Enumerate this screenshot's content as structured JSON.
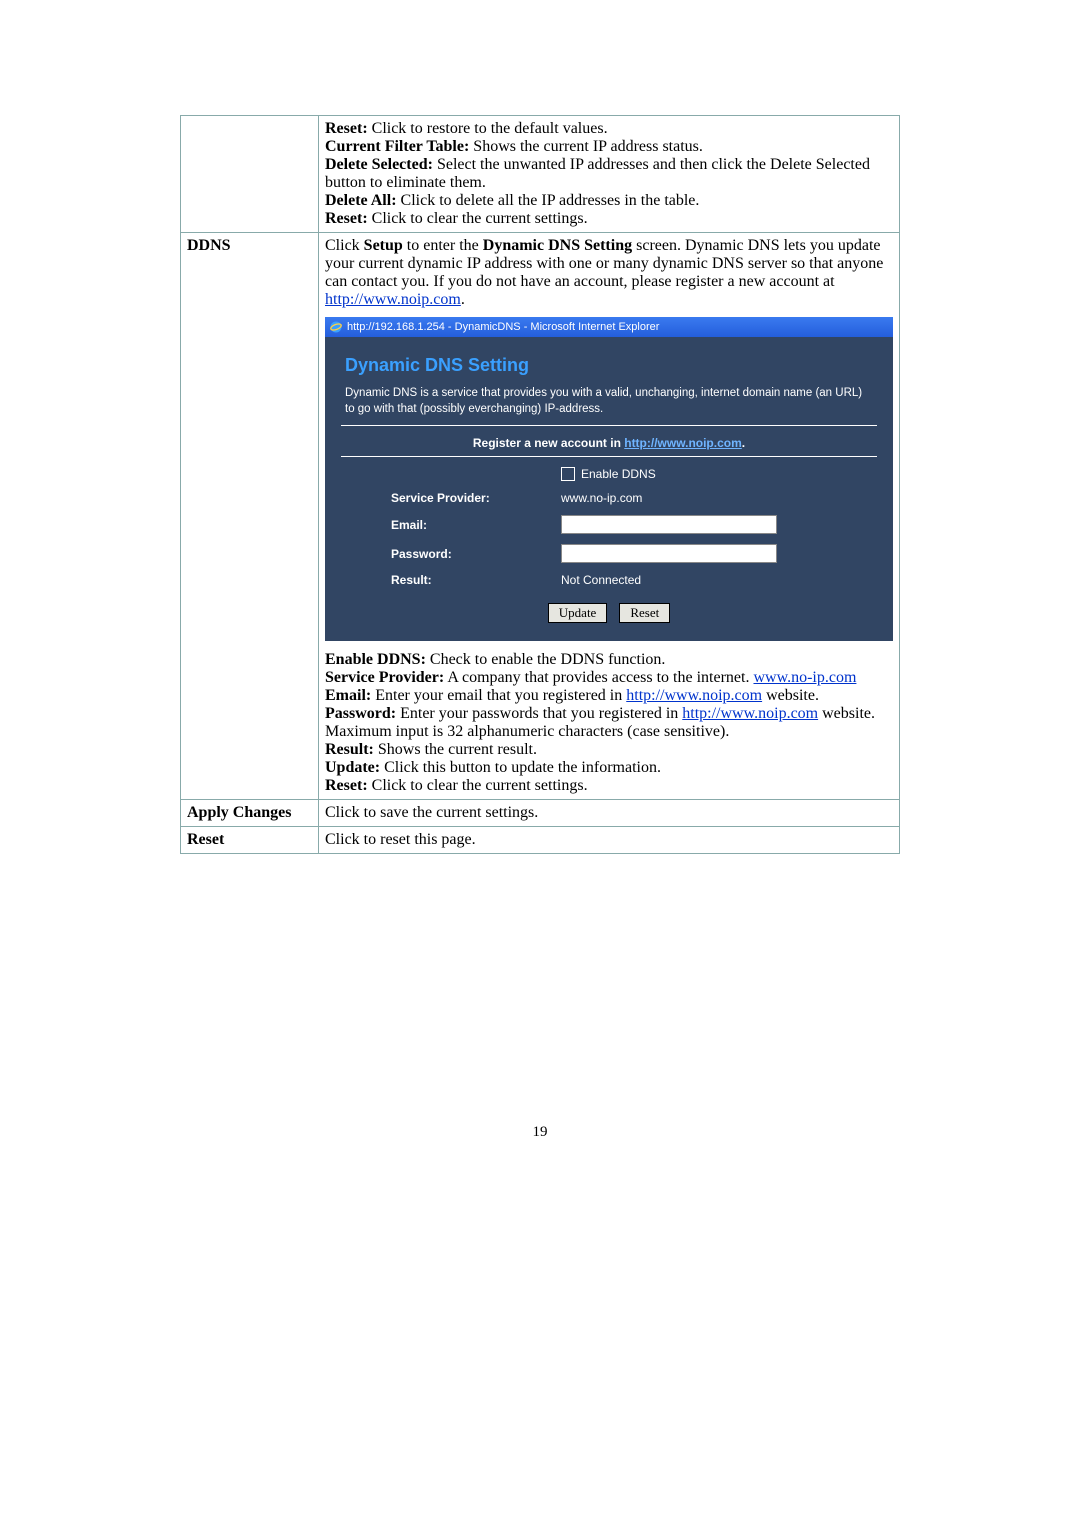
{
  "page_number": "19",
  "rows": {
    "first_cell": {
      "reset": "Reset:",
      "reset_text": " Click to restore to the default values.",
      "cft": "Current Filter Table:",
      "cft_text": " Shows the current IP address status.",
      "ds": "Delete Selected:",
      "ds_text": " Select the unwanted IP addresses and then click the Delete Selected button to eliminate them.",
      "da": "Delete All:",
      "da_text": " Click to delete all the IP addresses in the table.",
      "reset2": "Reset:",
      "reset2_text": " Click to clear the current settings."
    },
    "ddns_label": "DDNS",
    "ddns_intro": {
      "pre": "Click ",
      "setup": "Setup",
      "mid": " to enter the ",
      "dds": "Dynamic DNS Setting",
      "post": " screen. Dynamic DNS lets you update your current dynamic IP address with one or many dynamic DNS server so that anyone can contact you. If you do not have an account, please register a new account at ",
      "link": "http://www.noip.com",
      "dot": "."
    },
    "panel": {
      "titlebar": "http://192.168.1.254 - DynamicDNS - Microsoft Internet Explorer",
      "heading": "Dynamic DNS  Setting",
      "desc": "Dynamic DNS is a service that provides you with a valid, unchanging, internet domain name (an URL) to go with that (possibly everchanging) IP-address.",
      "register_prefix": "Register a new account in ",
      "register_link": "http://www.noip.com",
      "register_suffix": ".",
      "enable_label": "Enable DDNS",
      "sp_label": "Service Provider:",
      "sp_value": "www.no-ip.com",
      "email_label": "Email:",
      "password_label": "Password:",
      "result_label": "Result:",
      "result_value": "Not Connected",
      "btn_update": "Update",
      "btn_reset": "Reset"
    },
    "ddns_expl": {
      "e1": "Enable DDNS:",
      "e1t": " Check to enable the DDNS function.",
      "sp": "Service Provider:",
      "spt_a": " A company that provides access to the internet. ",
      "sp_link": "www.no-ip.com",
      "em": "Email:",
      "emt_a": " Enter your email that you registered in ",
      "em_link": "http://www.noip.com",
      "emt_b": " website.",
      "pw": "Password:",
      "pwt_a": " Enter your passwords that you registered in ",
      "pw_link": "http://www.noip.com",
      "pwt_b": " website. Maximum input is 32 alphanumeric characters (case sensitive).",
      "rs": "Result:",
      "rst": " Shows the current result.",
      "up": "Update:",
      "upt": " Click this button to update the information.",
      "re": "Reset:",
      "ret": " Click to clear the current settings."
    },
    "apply_label": "Apply Changes",
    "apply_text": "Click to save the current settings.",
    "reset_label": "Reset",
    "reset_text": "Click to reset this page."
  }
}
